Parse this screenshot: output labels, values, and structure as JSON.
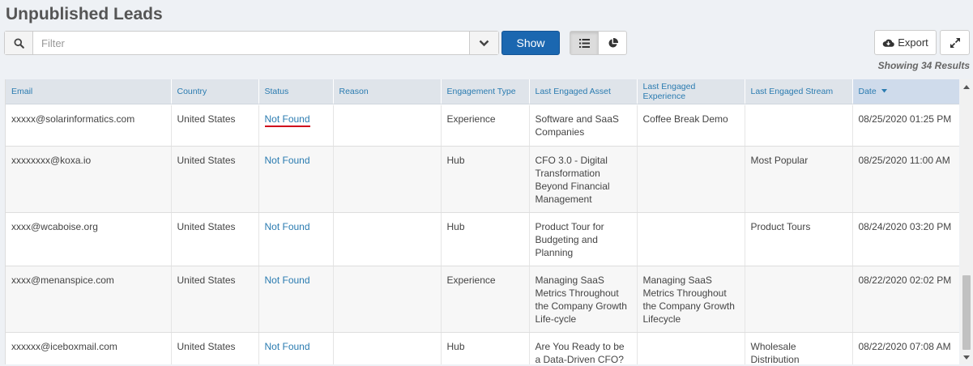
{
  "page": {
    "title": "Unpublished Leads"
  },
  "toolbar": {
    "filter_placeholder": "Filter",
    "show_label": "Show",
    "export_label": "Export",
    "results_text": "Showing 34 Results"
  },
  "icons": {
    "search": "search-icon",
    "dropdown": "chevron-down-icon",
    "list_view": "list-icon",
    "chart_view": "pie-chart-icon",
    "export": "cloud-download-icon",
    "expand": "expand-icon",
    "sort": "caret-down-icon"
  },
  "colors": {
    "accent": "#1b67b0",
    "link": "#2a7bb0",
    "highlight": "#d0021b"
  },
  "table": {
    "columns": [
      "Email",
      "Country",
      "Status",
      "Reason",
      "Engagement Type",
      "Last Engaged Asset",
      "Last Engaged Experience",
      "Last Engaged Stream",
      "Date"
    ],
    "sorted_column": "Date",
    "rows": [
      {
        "email": "xxxxx@solarinformatics.com",
        "country": "United States",
        "status": "Not Found",
        "reason": "",
        "engagement_type": "Experience",
        "asset": "Software and SaaS Companies",
        "experience": "Coffee Break Demo",
        "stream": "",
        "date": "08/25/2020 01:25 PM"
      },
      {
        "email": "xxxxxxxx@koxa.io",
        "country": "United States",
        "status": "Not Found",
        "reason": "",
        "engagement_type": "Hub",
        "asset": "CFO 3.0 - Digital Transformation Beyond Financial Management",
        "experience": "",
        "stream": "Most Popular",
        "date": "08/25/2020 11:00 AM"
      },
      {
        "email": "xxxx@wcaboise.org",
        "country": "United States",
        "status": "Not Found",
        "reason": "",
        "engagement_type": "Hub",
        "asset": "Product Tour for Budgeting and Planning",
        "experience": "",
        "stream": "Product Tours",
        "date": "08/24/2020 03:20 PM"
      },
      {
        "email": "xxxx@menanspice.com",
        "country": "United States",
        "status": "Not Found",
        "reason": "",
        "engagement_type": "Experience",
        "asset": "Managing SaaS Metrics Throughout the Company Growth Life-cycle",
        "experience": "Managing SaaS Metrics Throughout the Company Growth Lifecycle",
        "stream": "",
        "date": "08/22/2020 02:02 PM"
      },
      {
        "email": "xxxxxx@iceboxmail.com",
        "country": "United States",
        "status": "Not Found",
        "reason": "",
        "engagement_type": "Hub",
        "asset": "Are You Ready to be a Data-Driven CFO?",
        "experience": "",
        "stream": "Wholesale Distribution",
        "date": "08/22/2020 07:08 AM"
      }
    ]
  }
}
